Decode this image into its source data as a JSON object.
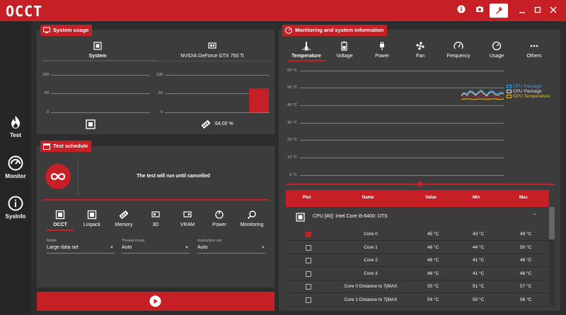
{
  "app": {
    "logo": "OCCT"
  },
  "titlebar": {
    "icons": [
      "info-icon",
      "camera-icon",
      "wrench-icon",
      "minimize-icon",
      "maximize-icon",
      "close-icon"
    ]
  },
  "sidenav": [
    {
      "label": "Test",
      "icon": "flame-icon"
    },
    {
      "label": "Monitor",
      "icon": "gauge-icon"
    },
    {
      "label": "SysInfo",
      "icon": "info-icon"
    }
  ],
  "system_usage": {
    "title": "System usage",
    "tabs": [
      "System",
      "NVIDIA GeForce GTX 750 Ti"
    ],
    "axis": [
      "100",
      "50",
      "0"
    ],
    "gpu_usage_label": "64,00 %",
    "gpu_usage_fraction": 0.64
  },
  "test_schedule": {
    "title": "Test schedule",
    "message": "The test will run until cancelled",
    "tabs": [
      "OCCT",
      "Linpack",
      "Memory",
      "3D",
      "VRAM",
      "Power",
      "Monitoring"
    ],
    "fields": [
      {
        "label": "Mode",
        "value": "Large data set"
      },
      {
        "label": "Thread count",
        "value": "Auto"
      },
      {
        "label": "Instruction set",
        "value": "Auto"
      }
    ]
  },
  "monitoring": {
    "title": "Monitoring and system information",
    "tabs": [
      "Temperature",
      "Voltage",
      "Power",
      "Fan",
      "Frequency",
      "Usage",
      "Others"
    ],
    "axis": [
      "60 °C",
      "50 °C",
      "40 °C",
      "30 °C",
      "20 °C",
      "10 °C",
      "0 °C"
    ],
    "legend": [
      "CPU Package",
      "CPU Package",
      "GPU Temperature"
    ],
    "legend_colors": [
      "#3aa0e0",
      "#e0e0e0",
      "#e0c030"
    ],
    "table": {
      "headers": [
        "Plot",
        "Name",
        "Value",
        "Min",
        "Max"
      ],
      "group": "CPU [#0]: Intel Core i5-6400: DTS",
      "rows": [
        {
          "checked": true,
          "name": "Core 0",
          "value": "45 °C",
          "min": "43 °C",
          "max": "49 °C"
        },
        {
          "checked": false,
          "name": "Core 1",
          "value": "46 °C",
          "min": "44 °C",
          "max": "50 °C"
        },
        {
          "checked": false,
          "name": "Core 2",
          "value": "46 °C",
          "min": "41 °C",
          "max": "46 °C"
        },
        {
          "checked": false,
          "name": "Core 3",
          "value": "46 °C",
          "min": "41 °C",
          "max": "46 °C"
        },
        {
          "checked": false,
          "name": "Core 0 Distance to TjMAX",
          "value": "55 °C",
          "min": "51 °C",
          "max": "57 °C"
        },
        {
          "checked": false,
          "name": "Core 1 Distance to TjMAX",
          "value": "54 °C",
          "min": "50 °C",
          "max": "56 °C"
        }
      ]
    }
  }
}
